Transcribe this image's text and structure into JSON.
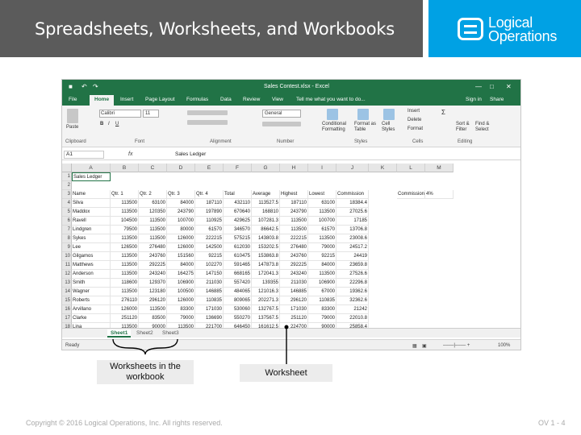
{
  "slide": {
    "title": "Spreadsheets, Worksheets, and Workbooks",
    "logo_line1": "Logical",
    "logo_line2": "Operations",
    "footer_copyright": "Copyright © 2016 Logical Operations, Inc. All rights reserved.",
    "footer_page": "OV 1 - 4"
  },
  "callouts": {
    "worksheets_in_workbook": "Worksheets in the workbook",
    "worksheet": "Worksheet"
  },
  "excel": {
    "window_title": "Sales Contest.xlsx - Excel",
    "tabs": [
      "File",
      "Home",
      "Insert",
      "Page Layout",
      "Formulas",
      "Data",
      "Review",
      "View"
    ],
    "tell_me": "Tell me what you want to do...",
    "sign_in": "Sign in",
    "share": "Share",
    "ribbon": {
      "paste": "Paste",
      "font_name": "Calibri",
      "font_size": "11",
      "number_format": "General",
      "conditional_formatting": "Conditional Formatting",
      "format_as_table": "Format as Table",
      "cell_styles": "Cell Styles",
      "insert": "Insert",
      "delete": "Delete",
      "format": "Format",
      "sort_filter": "Sort & Filter",
      "find_select": "Find & Select",
      "groups": [
        "Clipboard",
        "Font",
        "Alignment",
        "Number",
        "Styles",
        "Cells",
        "Editing"
      ]
    },
    "name_box": "A1",
    "formula_value": "Sales Ledger",
    "columns": [
      "A",
      "B",
      "C",
      "D",
      "E",
      "F",
      "G",
      "H",
      "I",
      "J",
      "K",
      "L",
      "M"
    ],
    "row_numbers": [
      "1",
      "2",
      "3",
      "4",
      "5",
      "6",
      "7",
      "8",
      "9",
      "10",
      "11",
      "12",
      "13",
      "14",
      "15",
      "16",
      "17",
      "18"
    ],
    "header_row": [
      "Name",
      "Qtr. 1",
      "Qtr. 2",
      "Qtr. 3",
      "Qtr. 4",
      "Total",
      "Average",
      "Highest",
      "Lowest",
      "Commission",
      "",
      "Commission",
      "4%"
    ],
    "a1": "Sales Ledger",
    "rows": [
      [
        "Silva",
        "113500",
        "63100",
        "84000",
        "187110",
        "432110",
        "113527.5",
        "187110",
        "63100",
        "18384.4"
      ],
      [
        "Maddox",
        "113500",
        "120350",
        "243790",
        "197890",
        "670640",
        "168810",
        "243790",
        "113500",
        "27025.6"
      ],
      [
        "Ravell",
        "104500",
        "113500",
        "100700",
        "110925",
        "429625",
        "107281.3",
        "113500",
        "100700",
        "17185"
      ],
      [
        "Lindgren",
        "79500",
        "113500",
        "80000",
        "61570",
        "346570",
        "86642.5",
        "113500",
        "61570",
        "13706.8"
      ],
      [
        "Sykes",
        "113500",
        "113500",
        "126000",
        "222215",
        "575215",
        "143803.8",
        "222215",
        "113500",
        "23008.6"
      ],
      [
        "Lee",
        "126500",
        "276480",
        "126000",
        "142500",
        "612030",
        "153202.5",
        "276480",
        "79000",
        "24517.2"
      ],
      [
        "Gilgamos",
        "113500",
        "243760",
        "151560",
        "92215",
        "610475",
        "153863.8",
        "243760",
        "92215",
        "24419"
      ],
      [
        "Matthews",
        "113500",
        "292225",
        "84000",
        "102270",
        "591465",
        "147873.8",
        "292225",
        "84000",
        "23659.8"
      ],
      [
        "Anderson",
        "113500",
        "243240",
        "164275",
        "147150",
        "668165",
        "172041.3",
        "243240",
        "113500",
        "27526.6"
      ],
      [
        "Smith",
        "118600",
        "129370",
        "106900",
        "211030",
        "557420",
        "139355",
        "211030",
        "106900",
        "22296.8"
      ],
      [
        "Wagner",
        "113500",
        "123180",
        "100500",
        "146885",
        "484065",
        "121016.3",
        "146885",
        "67000",
        "19362.6"
      ],
      [
        "Roberts",
        "276110",
        "296120",
        "126000",
        "110835",
        "809065",
        "202271.3",
        "296120",
        "110835",
        "32362.6"
      ],
      [
        "Arvillano",
        "126000",
        "113500",
        "83300",
        "171030",
        "530060",
        "132767.5",
        "171030",
        "83300",
        "21242"
      ],
      [
        "Clarke",
        "251120",
        "83500",
        "79000",
        "136690",
        "550270",
        "137567.5",
        "251120",
        "79000",
        "22010.8"
      ],
      [
        "Lina",
        "113500",
        "90000",
        "113500",
        "221700",
        "646450",
        "161612.5",
        "224700",
        "90000",
        "25858.4"
      ]
    ],
    "sheet_tabs": [
      "Sheet1",
      "Sheet2",
      "Sheet3"
    ],
    "status_ready": "Ready",
    "zoom": "100%"
  }
}
